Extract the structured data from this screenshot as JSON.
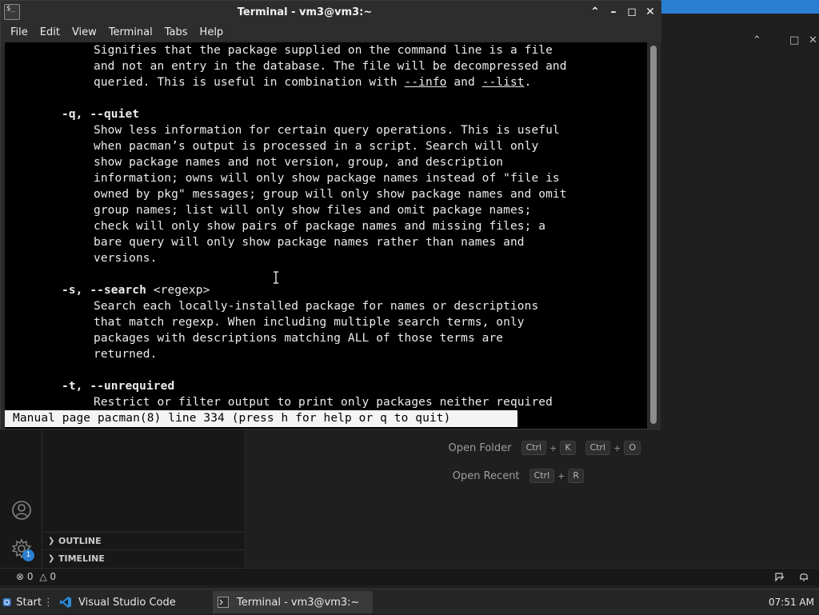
{
  "terminal": {
    "title": "Terminal - vm3@vm3:~",
    "menu": [
      "File",
      "Edit",
      "View",
      "Terminal",
      "Tabs",
      "Help"
    ],
    "lines": [
      {
        "indent": 2,
        "segments": [
          {
            "t": "Signifies that the package supplied on the command line is a file"
          }
        ]
      },
      {
        "indent": 2,
        "segments": [
          {
            "t": "and not an entry in the database. The file will be decompressed and"
          }
        ]
      },
      {
        "indent": 2,
        "segments": [
          {
            "t": "queried. This is useful in combination with "
          },
          {
            "t": "--info",
            "u": true
          },
          {
            "t": " and "
          },
          {
            "t": "--list",
            "u": true
          },
          {
            "t": "."
          }
        ]
      },
      {
        "indent": 0,
        "segments": []
      },
      {
        "indent": 1,
        "segments": [
          {
            "t": "-q, --quiet",
            "b": true
          }
        ]
      },
      {
        "indent": 2,
        "segments": [
          {
            "t": "Show less information for certain query operations. This is useful"
          }
        ]
      },
      {
        "indent": 2,
        "segments": [
          {
            "t": "when pacman’s output is processed in a script. Search will only"
          }
        ]
      },
      {
        "indent": 2,
        "segments": [
          {
            "t": "show package names and not version, group, and description"
          }
        ]
      },
      {
        "indent": 2,
        "segments": [
          {
            "t": "information; owns will only show package names instead of \"file is"
          }
        ]
      },
      {
        "indent": 2,
        "segments": [
          {
            "t": "owned by pkg\" messages; group will only show package names and omit"
          }
        ]
      },
      {
        "indent": 2,
        "segments": [
          {
            "t": "group names; list will only show files and omit package names;"
          }
        ]
      },
      {
        "indent": 2,
        "segments": [
          {
            "t": "check will only show pairs of package names and missing files; a"
          }
        ]
      },
      {
        "indent": 2,
        "segments": [
          {
            "t": "bare query will only show package names rather than names and"
          }
        ]
      },
      {
        "indent": 2,
        "segments": [
          {
            "t": "versions."
          }
        ]
      },
      {
        "indent": 0,
        "segments": []
      },
      {
        "indent": 1,
        "segments": [
          {
            "t": "-s, --search",
            "b": true
          },
          {
            "t": " <regexp>"
          }
        ]
      },
      {
        "indent": 2,
        "segments": [
          {
            "t": "Search each locally-installed package for names or descriptions"
          }
        ]
      },
      {
        "indent": 2,
        "segments": [
          {
            "t": "that match regexp. When including multiple search terms, only"
          }
        ]
      },
      {
        "indent": 2,
        "segments": [
          {
            "t": "packages with descriptions matching ALL of those terms are"
          }
        ]
      },
      {
        "indent": 2,
        "segments": [
          {
            "t": "returned."
          }
        ]
      },
      {
        "indent": 0,
        "segments": []
      },
      {
        "indent": 1,
        "segments": [
          {
            "t": "-t, --unrequired",
            "b": true
          }
        ]
      },
      {
        "indent": 2,
        "segments": [
          {
            "t": "Restrict or filter output to print only packages neither required"
          }
        ]
      }
    ],
    "status_line": "Manual page pacman(8) line 334 (press h for help or q to quit)"
  },
  "vscode": {
    "welcome": {
      "open_folder": {
        "label": "Open Folder",
        "keys": [
          [
            "Ctrl",
            "K"
          ],
          [
            "Ctrl",
            "O"
          ]
        ]
      },
      "open_recent": {
        "label": "Open Recent",
        "keys": [
          [
            "Ctrl",
            "R"
          ]
        ]
      }
    },
    "sidebar_sections": [
      "OUTLINE",
      "TIMELINE"
    ],
    "settings_badge": "1",
    "status": {
      "errors": "0",
      "warnings": "0"
    }
  },
  "taskbar": {
    "start_label": "Start",
    "items": [
      {
        "label": "Visual Studio Code",
        "icon": "vscode-icon",
        "active": false
      },
      {
        "label": "Terminal - vm3@vm3:~",
        "icon": "terminal-icon",
        "active": true
      }
    ],
    "clock": "07:51 AM"
  },
  "colors": {
    "vscode_accent": "#2a7fd4",
    "terminal_bg": "#000000",
    "terminal_fg": "#ececec"
  }
}
